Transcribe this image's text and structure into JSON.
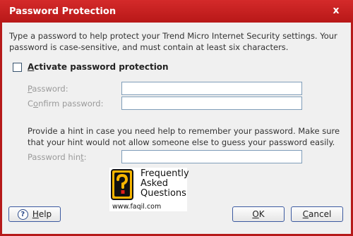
{
  "window": {
    "title": "Password Protection",
    "close_glyph": "x"
  },
  "intro_text": "Type a password to help protect your Trend Micro Internet Security settings. Your password is case-sensitive, and must contain at least six characters.",
  "activate": {
    "label_pre": "",
    "label_access": "A",
    "label_post": "ctivate password protection",
    "checked": false
  },
  "password": {
    "label_access": "P",
    "label_post": "assword:",
    "value": ""
  },
  "confirm": {
    "label_pre": "C",
    "label_access": "o",
    "label_post": "nfirm password:",
    "value": ""
  },
  "hint_text": "Provide a hint in case you need help to remember your password. Make sure that your hint would not allow someone else to guess your password easily.",
  "hint": {
    "label_pre": "Password hin",
    "label_access": "t",
    "label_post": ":",
    "value": ""
  },
  "watermark": {
    "line1": "Frequently",
    "line2": "Asked",
    "line3": "Questions",
    "url": "www.faqil.com",
    "icon": "question-mark-icon"
  },
  "buttons": {
    "help_access": "H",
    "help_post": "elp",
    "ok_access": "O",
    "ok_post": "K",
    "cancel_access": "C",
    "cancel_post": "ancel"
  },
  "colors": {
    "titlebar": "#c41f1f",
    "background": "#f0f0f0",
    "field_border": "#7f9db9",
    "disabled_text": "#9a9a9a"
  }
}
